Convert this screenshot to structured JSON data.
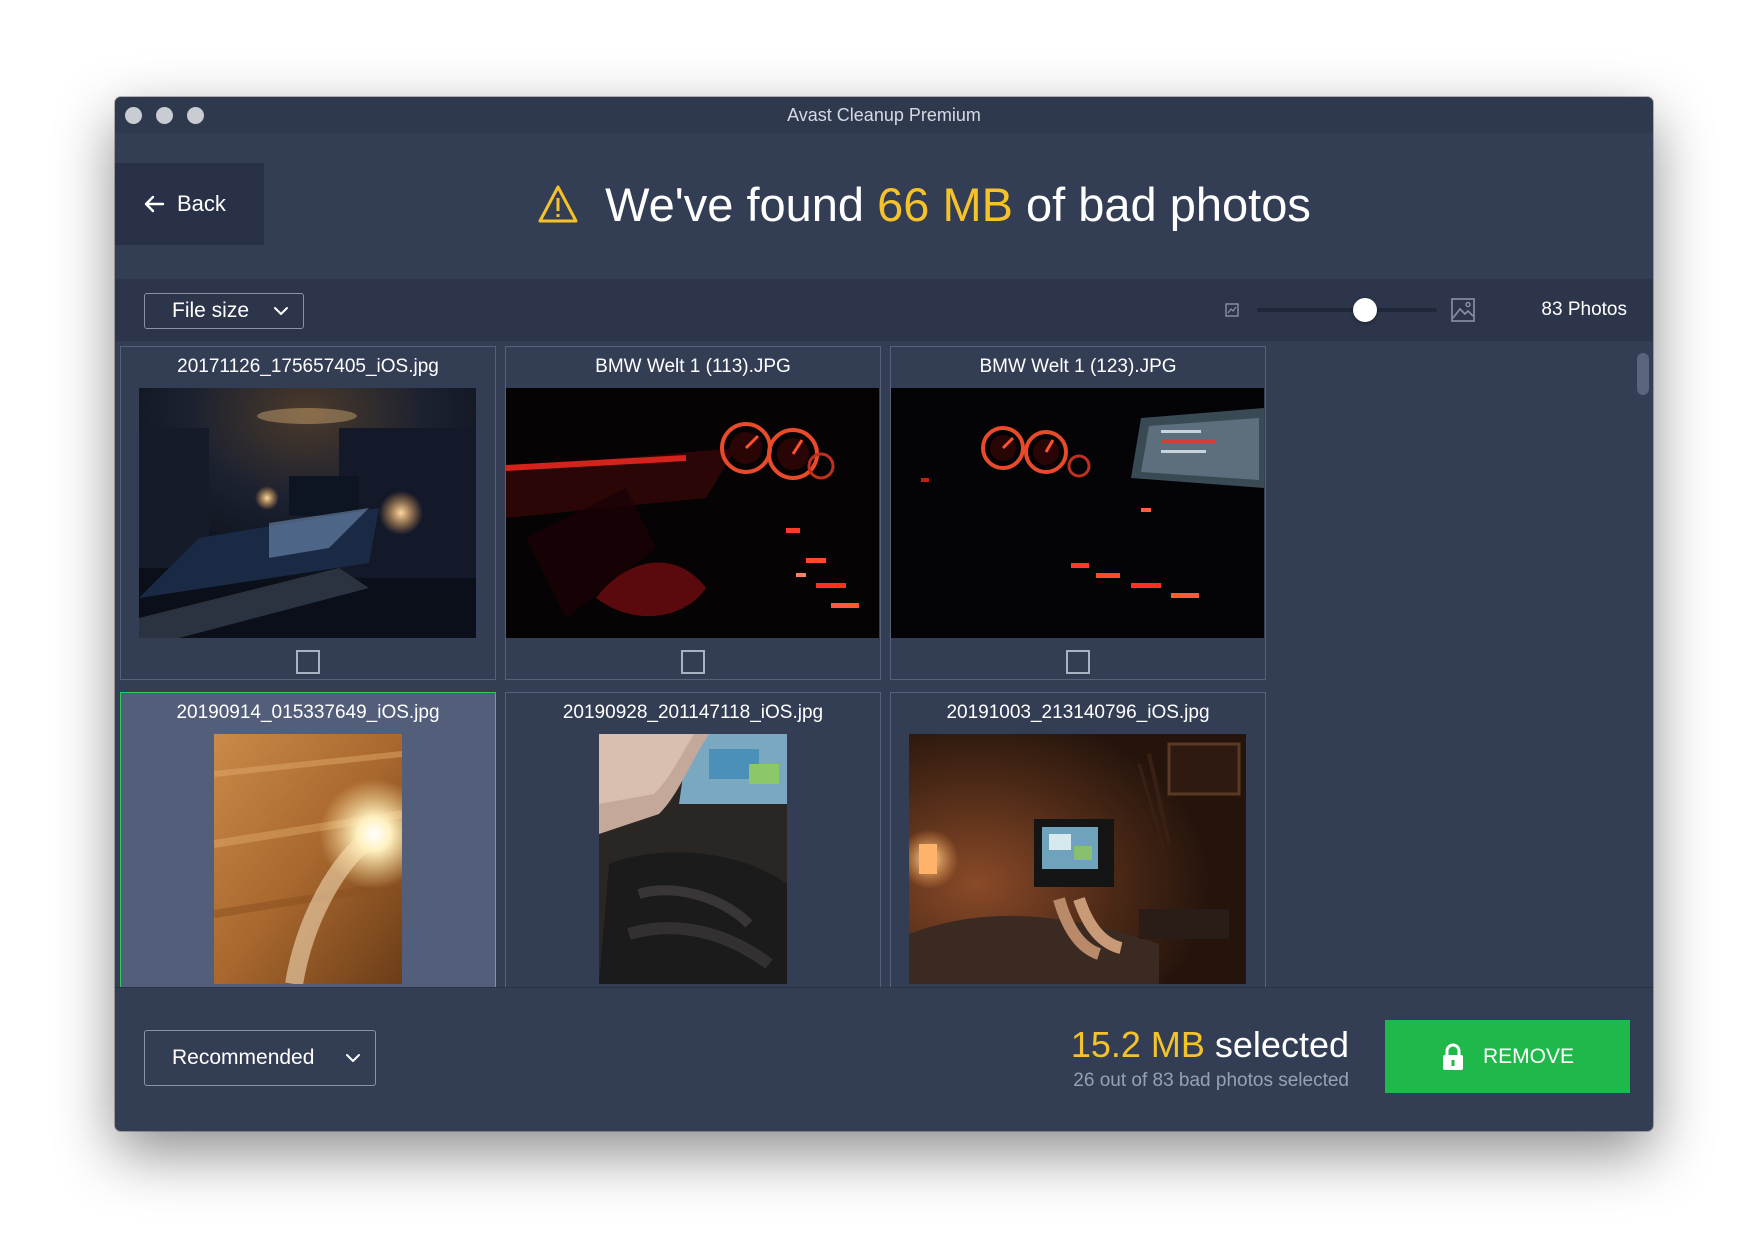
{
  "window": {
    "title": "Avast Cleanup Premium"
  },
  "header": {
    "back_label": "Back",
    "headline_prefix": "We've found ",
    "headline_amount": "66 MB",
    "headline_suffix": " of bad photos"
  },
  "toolbar": {
    "sort_label": "File size",
    "zoom_level": 0.6,
    "photo_count": "83 Photos"
  },
  "photos": [
    {
      "filename": "20171126_175657405_iOS.jpg",
      "checked": false,
      "highlighted": false
    },
    {
      "filename": "BMW Welt 1 (113).JPG",
      "checked": false,
      "highlighted": false
    },
    {
      "filename": "BMW Welt 1 (123).JPG",
      "checked": false,
      "highlighted": false
    },
    {
      "filename": "20190914_015337649_iOS.jpg",
      "checked": false,
      "highlighted": true
    },
    {
      "filename": "20190928_201147118_iOS.jpg",
      "checked": false,
      "highlighted": false
    },
    {
      "filename": "20191003_213140796_iOS.jpg",
      "checked": false,
      "highlighted": false
    }
  ],
  "footer": {
    "profile_label": "Recommended",
    "selected_amount": "15.2 MB",
    "selected_suffix": " selected",
    "selected_detail": "26 out of 83 bad photos selected",
    "remove_label": "REMOVE"
  },
  "colors": {
    "accent_yellow": "#f5c22a",
    "remove_green": "#1fb84a",
    "selected_border": "#2ecc5a",
    "window_bg": "#333e55"
  }
}
